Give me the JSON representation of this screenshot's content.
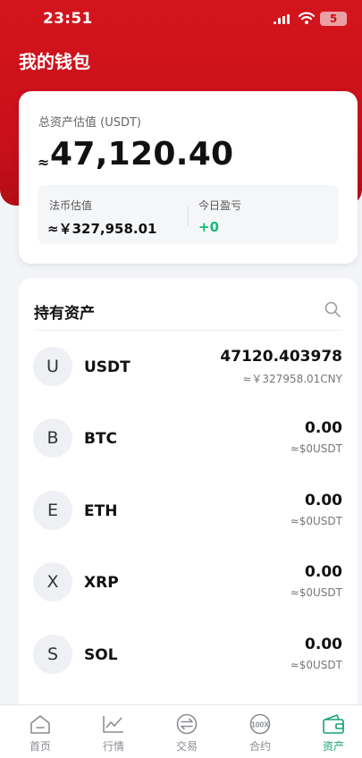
{
  "status": {
    "time": "23:51",
    "battery": "5"
  },
  "header": {
    "title": "我的钱包"
  },
  "summary": {
    "label": "总资产估值 (USDT)",
    "approx_symbol": "≈",
    "total": "47,120.40",
    "fiat_label": "法币估值",
    "fiat_value": "≈￥327,958.01",
    "pnl_label": "今日盈亏",
    "pnl_value": "+0"
  },
  "holdings": {
    "title": "持有资产",
    "items": [
      {
        "initial": "U",
        "symbol": "USDT",
        "amount": "47120.403978",
        "value": "≈￥327958.01CNY"
      },
      {
        "initial": "B",
        "symbol": "BTC",
        "amount": "0.00",
        "value": "≈$0USDT"
      },
      {
        "initial": "E",
        "symbol": "ETH",
        "amount": "0.00",
        "value": "≈$0USDT"
      },
      {
        "initial": "X",
        "symbol": "XRP",
        "amount": "0.00",
        "value": "≈$0USDT"
      },
      {
        "initial": "S",
        "symbol": "SOL",
        "amount": "0.00",
        "value": "≈$0USDT"
      }
    ]
  },
  "tabs": [
    {
      "label": "首页",
      "icon": "home-icon"
    },
    {
      "label": "行情",
      "icon": "chart-icon"
    },
    {
      "label": "交易",
      "icon": "exchange-icon"
    },
    {
      "label": "合约",
      "icon": "contract-100x-icon"
    },
    {
      "label": "资产",
      "icon": "wallet-icon",
      "active": true
    }
  ],
  "colors": {
    "brand_red": "#c8101a",
    "positive_green": "#16b979",
    "active_tab": "#16a36d"
  }
}
